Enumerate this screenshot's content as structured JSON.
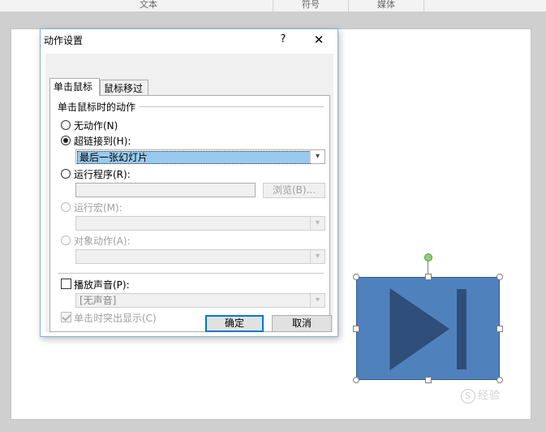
{
  "ribbon": {
    "groups": [
      "文本",
      "符号",
      "媒体"
    ]
  },
  "dialog": {
    "title": "动作设置",
    "help_label": "?",
    "close_label": "✕",
    "tabs": [
      {
        "label": "单击鼠标",
        "active": true
      },
      {
        "label": "鼠标移过",
        "active": false
      }
    ],
    "section_label": "单击鼠标时的动作",
    "options": {
      "none": {
        "label": "无动作(N)",
        "selected": false
      },
      "hyperlink": {
        "label": "超链接到(H):",
        "selected": true,
        "value": "最后一张幻灯片"
      },
      "run_program": {
        "label": "运行程序(R):",
        "selected": false,
        "value": "",
        "browse_label": "浏览(B)..."
      },
      "run_macro": {
        "label": "运行宏(M):",
        "enabled": false,
        "value": ""
      },
      "object_action": {
        "label": "对象动作(A):",
        "enabled": false,
        "value": ""
      }
    },
    "play_sound": {
      "label": "播放声音(P):",
      "checked": false,
      "value": "[无声音]"
    },
    "highlight_click": {
      "label": "单击时突出显示(C)",
      "checked": true,
      "enabled": false
    },
    "ok_label": "确定",
    "cancel_label": "取消"
  },
  "shape": {
    "name": "action-button-end-icon",
    "fill_color": "#4f81bd",
    "icon_color": "#2f4f7a"
  },
  "watermark": {
    "text": "经验"
  }
}
